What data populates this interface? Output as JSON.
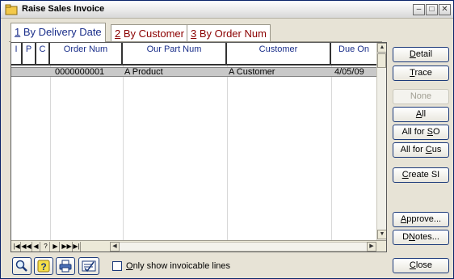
{
  "window": {
    "title": "Raise Sales Invoice",
    "controls": {
      "minimize": "–",
      "maximize": "□",
      "close": "✕"
    }
  },
  "tabs": [
    {
      "key": "1",
      "label": " By Delivery Date",
      "active": true
    },
    {
      "key": "2",
      "label": " By Customer",
      "active": false
    },
    {
      "key": "3",
      "label": " By Order Num",
      "active": false
    }
  ],
  "grid": {
    "columns": [
      "I",
      "P",
      "C",
      "Order Num",
      "Our Part Num",
      "Customer",
      "Due On"
    ],
    "rows": [
      {
        "order_num": "0000000001",
        "part_num": "A Product",
        "customer": "A Customer",
        "due_on": "4/05/09"
      }
    ],
    "nav_buttons": [
      "|◀",
      "◀◀",
      "◀",
      "?",
      "▶",
      "▶▶",
      "▶|"
    ]
  },
  "buttons": {
    "detail": {
      "prefix": "",
      "key": "D",
      "rest": "etail"
    },
    "trace": {
      "prefix": "",
      "key": "T",
      "rest": "race"
    },
    "none": {
      "prefix": "",
      "key": "",
      "rest": "None"
    },
    "all": {
      "prefix": "",
      "key": "A",
      "rest": "ll"
    },
    "all_for_so": {
      "prefix": "All for ",
      "key": "S",
      "rest": "O"
    },
    "all_for_cus": {
      "prefix": "All for ",
      "key": "C",
      "rest": "us"
    },
    "create_si": {
      "prefix": "",
      "key": "C",
      "rest": "reate SI"
    },
    "approve": {
      "prefix": "",
      "key": "A",
      "rest": "pprove..."
    },
    "dnotes": {
      "prefix": "D",
      "key": "N",
      "rest": "otes..."
    },
    "close": {
      "prefix": "",
      "key": "C",
      "rest": "lose"
    }
  },
  "toolbar": {
    "icons": [
      "magnifier-icon",
      "help-icon",
      "printer-icon",
      "checklist-icon"
    ]
  },
  "filter": {
    "checked": false,
    "label_key": "O",
    "label_rest": "nly show invoicable lines"
  },
  "colors": {
    "title_tab_active": "#1a2e8a",
    "tab_inactive": "#8b0000",
    "window_bg": "#e7e3d6",
    "selected_row": "#c8c8c8"
  }
}
